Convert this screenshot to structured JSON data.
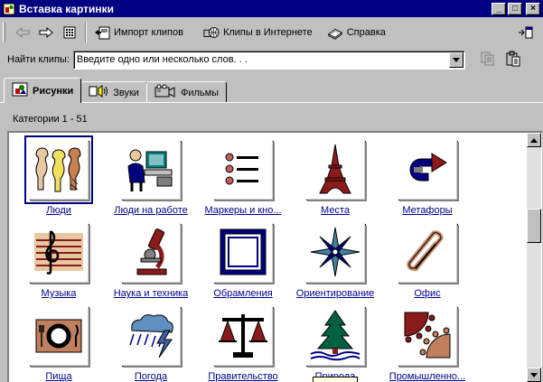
{
  "window": {
    "title": "Вставка картинки",
    "minimize": "_",
    "maximize": "□",
    "close": "×"
  },
  "toolbar": {
    "import_label": "Импорт клипов",
    "online_label": "Клипы в Интернете",
    "help_label": "Справка"
  },
  "search": {
    "label": "Найти клипы:",
    "placeholder": "Введите одно или несколько слов. . ."
  },
  "tabs": [
    {
      "label": "Рисунки",
      "active": true
    },
    {
      "label": "Звуки",
      "active": false
    },
    {
      "label": "Фильмы",
      "active": false
    }
  ],
  "categories_count": "Категории 1 - 51",
  "clips": [
    {
      "label": "Люди",
      "icon": "people-icon"
    },
    {
      "label": "Люди на работе",
      "icon": "people-at-work-icon"
    },
    {
      "label": "Маркеры и кно...",
      "icon": "bullets-icon"
    },
    {
      "label": "Места",
      "icon": "eiffel-tower-icon"
    },
    {
      "label": "Метафоры",
      "icon": "metaphor-arrow-icon"
    },
    {
      "label": "Музыка",
      "icon": "treble-clef-icon"
    },
    {
      "label": "Наука и техника",
      "icon": "microscope-icon"
    },
    {
      "label": "Обрамления",
      "icon": "frame-icon"
    },
    {
      "label": "Ориентирование",
      "icon": "compass-rose-icon"
    },
    {
      "label": "Офис",
      "icon": "paperclip-icon"
    },
    {
      "label": "Пища",
      "icon": "plate-icon"
    },
    {
      "label": "Погода",
      "icon": "storm-cloud-icon"
    },
    {
      "label": "Правительство",
      "icon": "scales-icon"
    },
    {
      "label": "Природа",
      "icon": "pine-tree-icon"
    },
    {
      "label": "Промышленно...",
      "icon": "gears-icon"
    }
  ],
  "colors": {
    "title_bar": "#000080",
    "link": "#00008b",
    "clip_brown": "#8b1a1a",
    "clip_tan": "#e8c8a0"
  }
}
